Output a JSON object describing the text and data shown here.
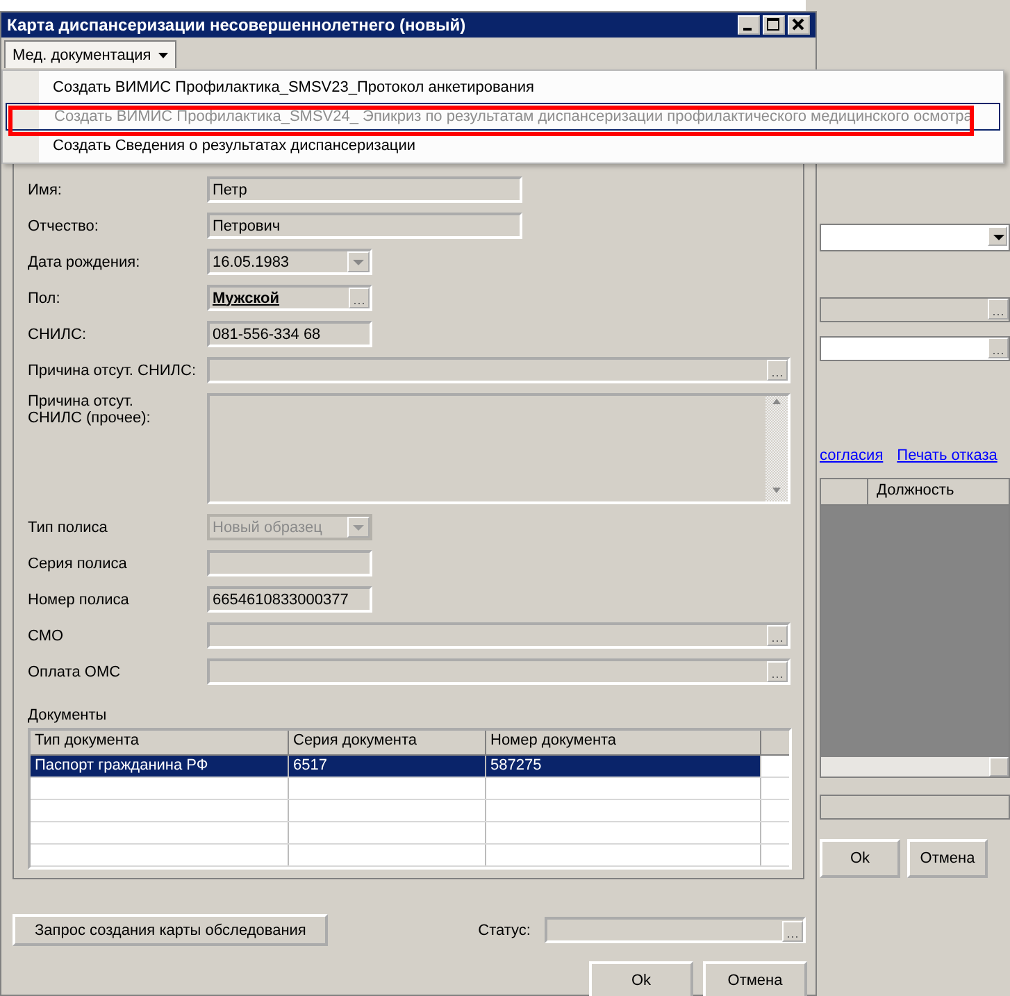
{
  "window": {
    "title": "Карта диспансеризации несовершеннолетнего (новый)"
  },
  "menu_button": {
    "label": "Мед. документация",
    "expanded": true
  },
  "dropdown": {
    "items": [
      {
        "label": "Создать ВИМИС Профилактика_SMSV23_Протокол анкетирования",
        "disabled": false,
        "selected": false,
        "highlighted": false
      },
      {
        "label": "Создать ВИМИС Профилактика_SMSV24_ Эпикриз по результатам диспансеризации профилактического медицинского осмотра",
        "disabled": true,
        "selected": true,
        "highlighted": true
      },
      {
        "label": "Создать Сведения о результатах диспансеризации",
        "disabled": false,
        "selected": false,
        "highlighted": false
      }
    ]
  },
  "form": {
    "fields": [
      {
        "kind": "text",
        "label": "Имя:",
        "value": "Петр",
        "bold": false,
        "disabled": false
      },
      {
        "kind": "text",
        "label": "Отчество:",
        "value": "Петрович",
        "bold": false,
        "disabled": false
      },
      {
        "kind": "date",
        "label": "Дата рождения:",
        "value": "16.05.1983",
        "bold": false,
        "disabled": false
      },
      {
        "kind": "lookup",
        "label": "Пол:",
        "value": "Мужской",
        "bold": true,
        "disabled": false
      },
      {
        "kind": "text",
        "label": "СНИЛС:",
        "value": "081-556-334 68",
        "bold": false,
        "disabled": false
      },
      {
        "kind": "lookup",
        "label": "Причина отсут. СНИЛС:",
        "disabled": false
      },
      {
        "kind": "memo",
        "label": "Причина отсут. СНИЛС (прочее):",
        "disabled": false
      },
      {
        "kind": "combo",
        "label": "Тип полиса",
        "value": "Новый образец",
        "bold": false,
        "disabled": true
      },
      {
        "kind": "text",
        "label": "Серия полиса",
        "disabled": false
      },
      {
        "kind": "text",
        "label": "Номер полиса",
        "value": "6654610833000377",
        "bold": false,
        "disabled": false
      },
      {
        "kind": "lookup",
        "label": "СМО",
        "disabled": false
      },
      {
        "kind": "lookup",
        "label": "Оплата ОМС",
        "disabled": false
      }
    ]
  },
  "documents": {
    "title": "Документы",
    "columns": [
      "Тип документа",
      "Серия документа",
      "Номер документа"
    ],
    "rows": [
      {
        "cells": [
          "Паспорт гражданина РФ",
          "6517",
          "587275"
        ],
        "selected": true
      }
    ]
  },
  "footer": {
    "request_button": "Запрос создания карты обследования",
    "status_label": "Статус:",
    "buttons": [
      "Ok",
      "Отмена"
    ]
  },
  "background_window": {
    "links": [
      "согласия",
      "Печать отказа"
    ],
    "column": "Должность",
    "buttons": [
      "Ok",
      "Отмена"
    ]
  }
}
